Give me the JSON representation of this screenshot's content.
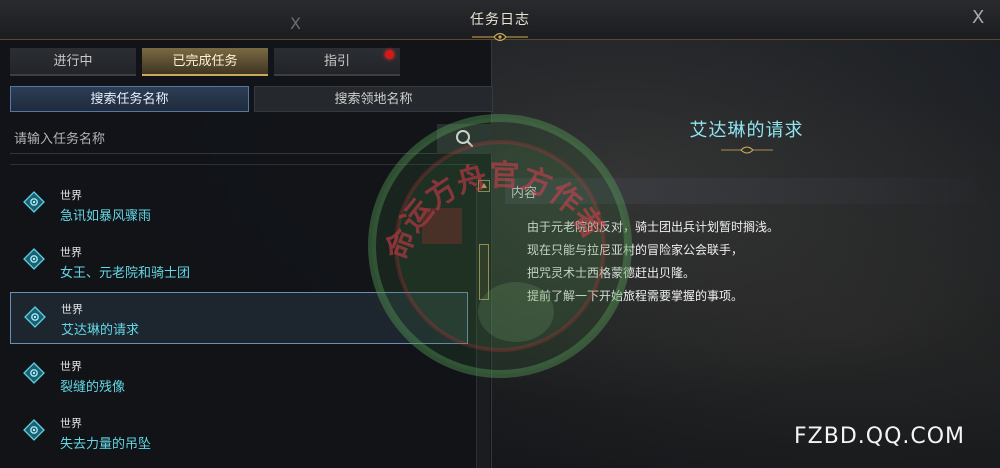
{
  "window": {
    "title": "任务日志",
    "close_glyph": "X"
  },
  "tabs": [
    {
      "label": "进行中",
      "active": false
    },
    {
      "label": "已完成任务",
      "active": true
    },
    {
      "label": "指引",
      "active": false,
      "notification": true
    }
  ],
  "search_modes": [
    {
      "label": "搜索任务名称",
      "active": true
    },
    {
      "label": "搜索领地名称",
      "active": false
    }
  ],
  "search": {
    "placeholder": "请输入任务名称",
    "value": "",
    "icon": "search-icon"
  },
  "quests": [
    {
      "category": "世界",
      "name": "急讯如暴风骤雨",
      "selected": false
    },
    {
      "category": "世界",
      "name": "女王、元老院和骑士团",
      "selected": false
    },
    {
      "category": "世界",
      "name": "艾达琳的请求",
      "selected": true
    },
    {
      "category": "世界",
      "name": "裂缝的残像",
      "selected": false
    },
    {
      "category": "世界",
      "name": "失去力量的吊坠",
      "selected": false
    }
  ],
  "detail": {
    "title": "艾达琳的请求",
    "section_label": "内容",
    "lines": [
      "由于元老院的反对，骑士团出兵计划暂时搁浅。",
      "现在只能与拉尼亚村的冒险家公会联手，",
      "把咒灵术士西格蒙德赶出贝隆。",
      "提前了解一下开始旅程需要掌握的事项。"
    ]
  },
  "watermark": {
    "site": "FZBD.QQ.COM",
    "stamp_text": "命运方舟官方作者"
  },
  "colors": {
    "accent_gold": "#c9a75c",
    "quest_name": "#63d7e6",
    "detail_title": "#8fe4ef",
    "notification": "#d61818"
  }
}
